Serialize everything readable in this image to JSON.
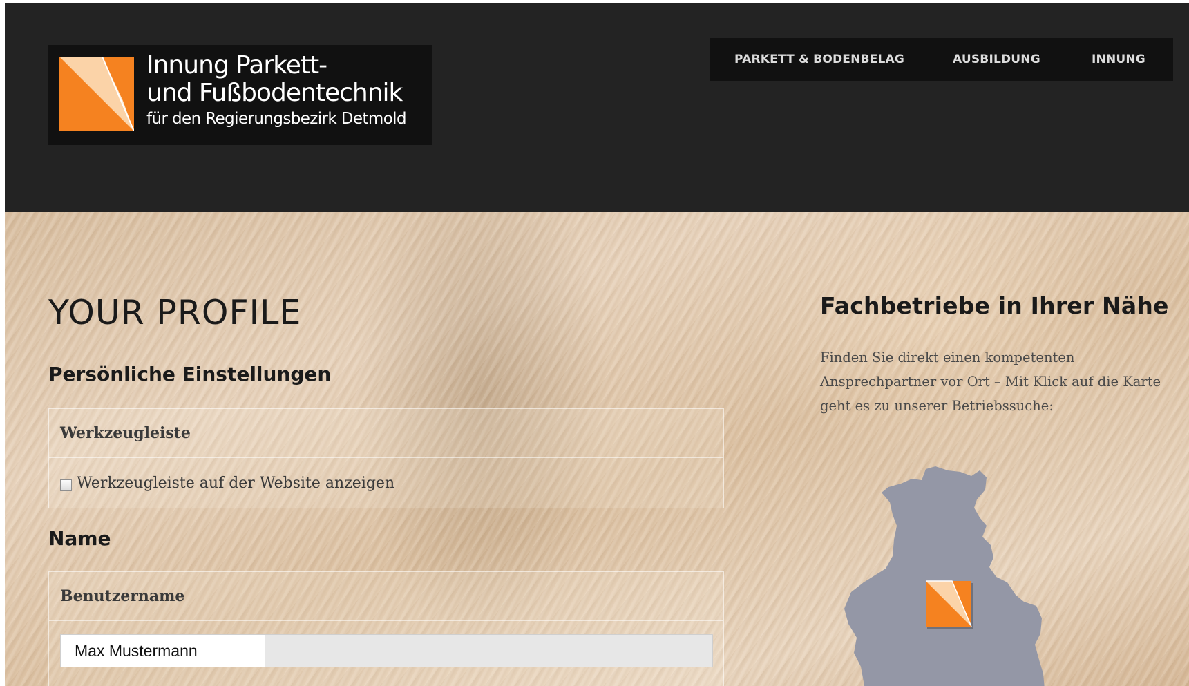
{
  "logo": {
    "line1": "Innung Parkett-",
    "line2": "und Fußbodentechnik",
    "line3": "für den Regierungsbezirk Detmold",
    "icon": "orange-diamond-logo-icon",
    "accent_color": "#f58220"
  },
  "nav": {
    "items": [
      {
        "label": "PARKETT & BODENBELAG"
      },
      {
        "label": "AUSBILDUNG"
      },
      {
        "label": "INNUNG"
      }
    ]
  },
  "main": {
    "title": "YOUR PROFILE",
    "settings": {
      "heading": "Persönliche Einstellungen",
      "toolbar_header": "Werkzeugleiste",
      "toolbar_checkbox_label": "Werkzeugleiste auf der Website anzeigen",
      "toolbar_checked": false
    },
    "name": {
      "heading": "Name",
      "username_header": "Benutzername",
      "username_value": "Max Mustermann"
    }
  },
  "sidebar": {
    "title": "Fachbetriebe in Ihrer Nähe",
    "text": "Finden Sie direkt einen kompetenten Ansprechpartner vor Ort – Mit Klick auf die Karte geht es zu unserer Betriebssuche:",
    "map_icon": "region-map-icon",
    "map_color": "#9497a6"
  }
}
